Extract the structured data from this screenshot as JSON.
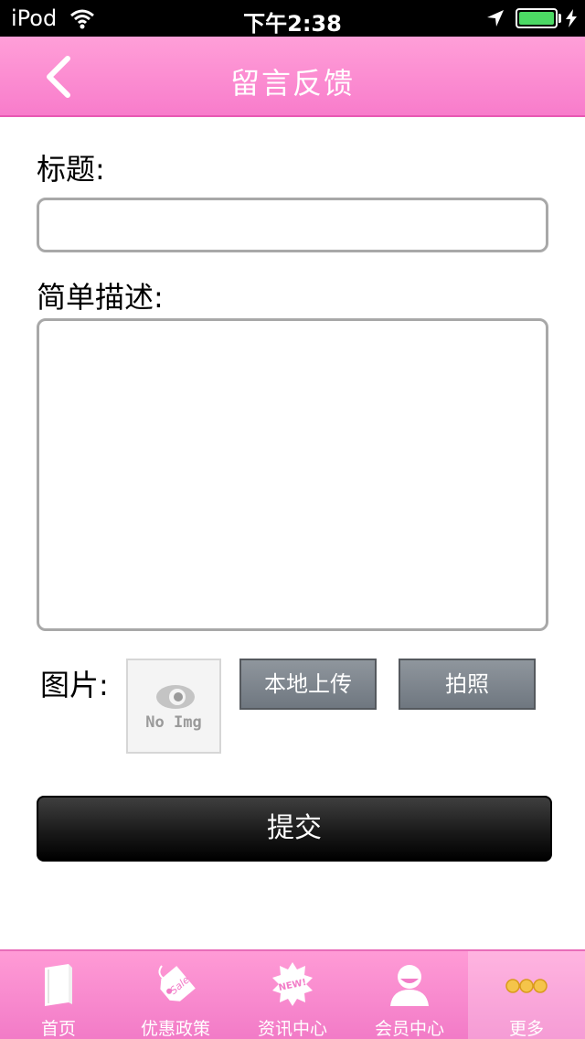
{
  "status_bar": {
    "carrier": "iPod",
    "time": "下午2:38"
  },
  "nav": {
    "title": "留言反馈",
    "back_icon": "chevron-left-icon"
  },
  "form": {
    "title_label": "标题:",
    "title_value": "",
    "desc_label": "简单描述:",
    "desc_value": "",
    "image_label": "图片:",
    "placeholder_image_text": "No Img",
    "upload_button": "本地上传",
    "photo_button": "拍照",
    "submit_button": "提交"
  },
  "tabs": [
    {
      "label": "首页",
      "icon": "book-icon"
    },
    {
      "label": "优惠政策",
      "icon": "sale-tag-icon"
    },
    {
      "label": "资讯中心",
      "icon": "new-badge-icon"
    },
    {
      "label": "会员中心",
      "icon": "user-icon"
    },
    {
      "label": "更多",
      "icon": "more-dots-icon",
      "active": true
    }
  ],
  "colors": {
    "accent": "#f87ccb",
    "battery": "#4cd964"
  }
}
